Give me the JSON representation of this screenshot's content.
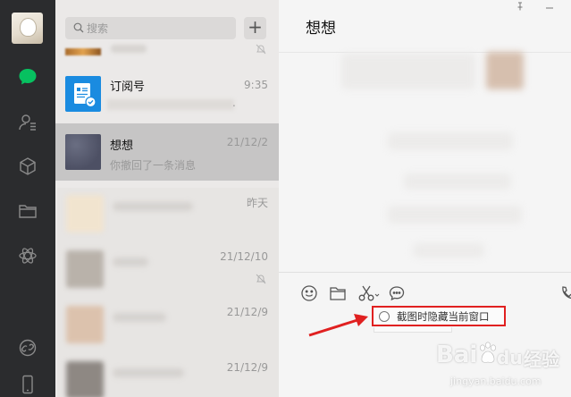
{
  "search": {
    "placeholder": "搜索"
  },
  "toolbar": {
    "add_label": "+"
  },
  "chats": [
    {
      "name": "订阅号",
      "time": "9:35",
      "preview": "."
    },
    {
      "name": "想想",
      "time": "21/12/2",
      "preview": "你撤回了一条消息"
    }
  ],
  "blurred_times": [
    "昨天",
    "21/12/10",
    "21/12/9",
    "21/12/9"
  ],
  "conversation": {
    "title": "想想"
  },
  "screenshot_option": {
    "label": "截图时隐藏当前窗口"
  },
  "watermark": {
    "brand": "Bai",
    "brand_suffix": "du",
    "cn": "经验",
    "url": "jingyan.baidu.com"
  },
  "colors": {
    "accent_green": "#07c160",
    "highlight_red": "#e02020",
    "rail_bg": "#2b2c2e"
  }
}
